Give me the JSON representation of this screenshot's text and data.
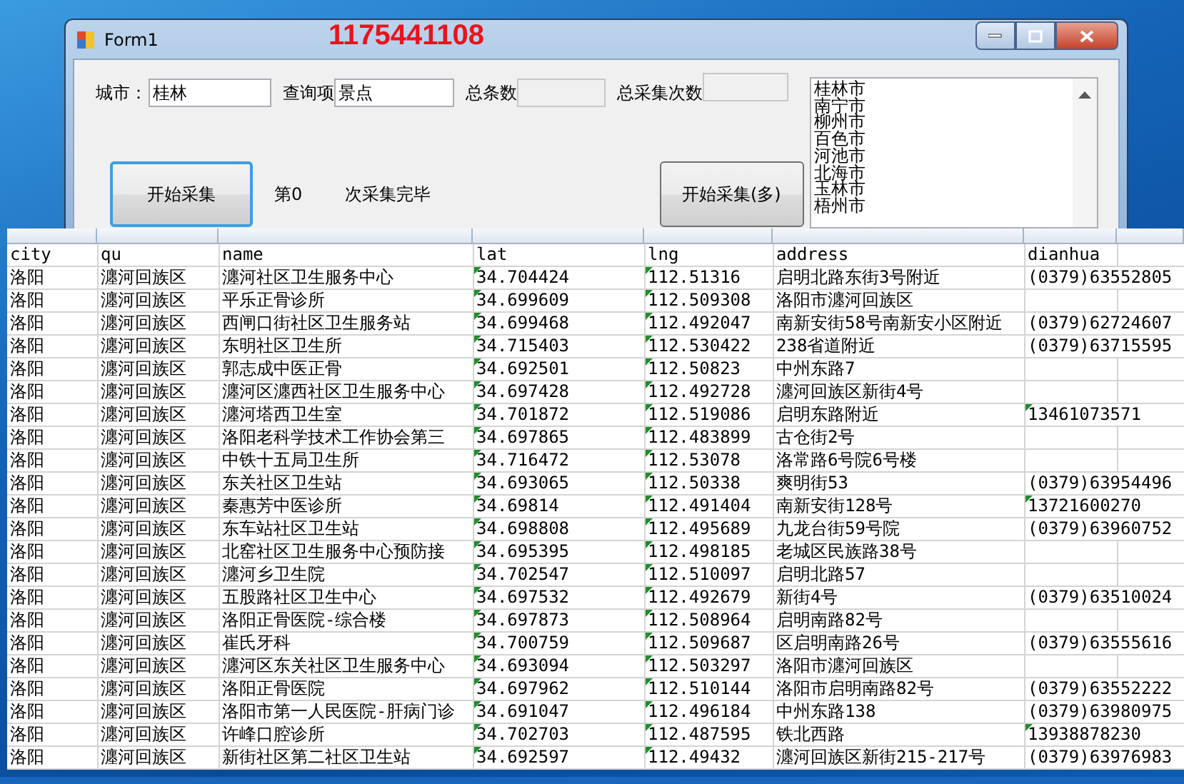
{
  "window": {
    "title": "Form1",
    "annotation": "1175441108"
  },
  "form": {
    "city_label": "城市：",
    "city_value": "桂林",
    "query_label": "查询项",
    "query_value": "景点",
    "total_label": "总条数",
    "count_label": "总采集次数",
    "start_button": "开始采集",
    "round_label": "第0",
    "status_label": "次采集完毕",
    "multi_button": "开始采集(多)",
    "cities": [
      "桂林市",
      "南宁市",
      "柳州市",
      "百色市",
      "河池市",
      "北海市",
      "玉林市",
      "梧州市"
    ]
  },
  "sheet": {
    "columns": [
      "city",
      "qu",
      "name",
      "lat",
      "lng",
      "address",
      "dianhua"
    ],
    "rows": [
      {
        "cells": [
          "洛阳",
          "瀍河回族区",
          "瀍河社区卫生服务中心",
          "34.704424",
          "112.51316",
          "启明北路东街3号附近",
          "(0379)63552805"
        ],
        "flags": [
          false,
          false,
          false,
          true,
          true,
          false,
          false
        ]
      },
      {
        "cells": [
          "洛阳",
          "瀍河回族区",
          "平乐正骨诊所",
          "34.699609",
          "112.509308",
          "洛阳市瀍河回族区",
          ""
        ],
        "flags": [
          false,
          false,
          false,
          true,
          true,
          false,
          false
        ]
      },
      {
        "cells": [
          "洛阳",
          "瀍河回族区",
          "西闸口街社区卫生服务站",
          "34.699468",
          "112.492047",
          "南新安街58号南新安小区附近",
          "(0379)62724607"
        ],
        "flags": [
          false,
          false,
          false,
          true,
          true,
          false,
          false
        ]
      },
      {
        "cells": [
          "洛阳",
          "瀍河回族区",
          "东明社区卫生所",
          "34.715403",
          "112.530422",
          "238省道附近",
          "(0379)63715595"
        ],
        "flags": [
          false,
          false,
          false,
          true,
          true,
          false,
          false
        ]
      },
      {
        "cells": [
          "洛阳",
          "瀍河回族区",
          "郭志成中医正骨",
          "34.692501",
          "112.50823",
          "中州东路7",
          ""
        ],
        "flags": [
          false,
          false,
          false,
          true,
          true,
          false,
          false
        ]
      },
      {
        "cells": [
          "洛阳",
          "瀍河回族区",
          "瀍河区瀍西社区卫生服务中心",
          "34.697428",
          "112.492728",
          "瀍河回族区新街4号",
          ""
        ],
        "flags": [
          false,
          false,
          false,
          true,
          true,
          false,
          false
        ]
      },
      {
        "cells": [
          "洛阳",
          "瀍河回族区",
          "瀍河塔西卫生室",
          "34.701872",
          "112.519086",
          "启明东路附近",
          "13461073571"
        ],
        "flags": [
          false,
          false,
          false,
          true,
          true,
          false,
          true
        ]
      },
      {
        "cells": [
          "洛阳",
          "瀍河回族区",
          "洛阳老科学技术工作协会第三",
          "34.697865",
          "112.483899",
          "古仓街2号",
          ""
        ],
        "flags": [
          false,
          false,
          false,
          true,
          true,
          false,
          false
        ]
      },
      {
        "cells": [
          "洛阳",
          "瀍河回族区",
          "中铁十五局卫生所",
          "34.716472",
          "112.53078",
          "洛常路6号院6号楼",
          ""
        ],
        "flags": [
          false,
          false,
          false,
          true,
          true,
          false,
          false
        ]
      },
      {
        "cells": [
          "洛阳",
          "瀍河回族区",
          "东关社区卫生站",
          "34.693065",
          "112.50338",
          "爽明街53",
          "(0379)63954496"
        ],
        "flags": [
          false,
          false,
          false,
          true,
          true,
          false,
          false
        ]
      },
      {
        "cells": [
          "洛阳",
          "瀍河回族区",
          "秦惠芳中医诊所",
          "34.69814",
          "112.491404",
          "南新安街128号",
          "13721600270"
        ],
        "flags": [
          false,
          false,
          false,
          true,
          true,
          false,
          true
        ]
      },
      {
        "cells": [
          "洛阳",
          "瀍河回族区",
          "东车站社区卫生站",
          "34.698808",
          "112.495689",
          "九龙台街59号院",
          "(0379)63960752"
        ],
        "flags": [
          false,
          false,
          false,
          true,
          true,
          false,
          false
        ]
      },
      {
        "cells": [
          "洛阳",
          "瀍河回族区",
          "北窑社区卫生服务中心预防接",
          "34.695395",
          "112.498185",
          "老城区民族路38号",
          ""
        ],
        "flags": [
          false,
          false,
          false,
          true,
          true,
          false,
          false
        ]
      },
      {
        "cells": [
          "洛阳",
          "瀍河回族区",
          "瀍河乡卫生院",
          "34.702547",
          "112.510097",
          "启明北路57",
          ""
        ],
        "flags": [
          false,
          false,
          false,
          true,
          true,
          false,
          false
        ]
      },
      {
        "cells": [
          "洛阳",
          "瀍河回族区",
          "五股路社区卫生中心",
          "34.697532",
          "112.492679",
          "新街4号",
          "(0379)63510024"
        ],
        "flags": [
          false,
          false,
          false,
          true,
          true,
          false,
          false
        ]
      },
      {
        "cells": [
          "洛阳",
          "瀍河回族区",
          "洛阳正骨医院-综合楼",
          "34.697873",
          "112.508964",
          "启明南路82号",
          ""
        ],
        "flags": [
          false,
          false,
          false,
          true,
          true,
          false,
          false
        ]
      },
      {
        "cells": [
          "洛阳",
          "瀍河回族区",
          "崔氏牙科",
          "34.700759",
          "112.509687",
          "区启明南路26号",
          "(0379)63555616"
        ],
        "flags": [
          false,
          false,
          false,
          true,
          true,
          false,
          false
        ]
      },
      {
        "cells": [
          "洛阳",
          "瀍河回族区",
          "瀍河区东关社区卫生服务中心",
          "34.693094",
          "112.503297",
          "洛阳市瀍河回族区",
          ""
        ],
        "flags": [
          false,
          false,
          false,
          true,
          true,
          false,
          false
        ]
      },
      {
        "cells": [
          "洛阳",
          "瀍河回族区",
          "洛阳正骨医院",
          "34.697962",
          "112.510144",
          "洛阳市启明南路82号",
          "(0379)63552222"
        ],
        "flags": [
          false,
          false,
          false,
          true,
          true,
          false,
          false
        ]
      },
      {
        "cells": [
          "洛阳",
          "瀍河回族区",
          "洛阳市第一人民医院-肝病门诊",
          "34.691047",
          "112.496184",
          "中州东路138",
          "(0379)63980975"
        ],
        "flags": [
          false,
          false,
          false,
          true,
          true,
          false,
          false
        ]
      },
      {
        "cells": [
          "洛阳",
          "瀍河回族区",
          "许峰口腔诊所",
          "34.702703",
          "112.487595",
          "铁北西路",
          "13938878230"
        ],
        "flags": [
          false,
          false,
          false,
          true,
          true,
          false,
          true
        ]
      },
      {
        "cells": [
          "洛阳",
          "瀍河回族区",
          "新街社区第二社区卫生站",
          "34.692597",
          "112.49432",
          "瀍河回族区新街215-217号",
          "(0379)63976983"
        ],
        "flags": [
          false,
          false,
          false,
          true,
          true,
          false,
          false
        ]
      }
    ]
  }
}
